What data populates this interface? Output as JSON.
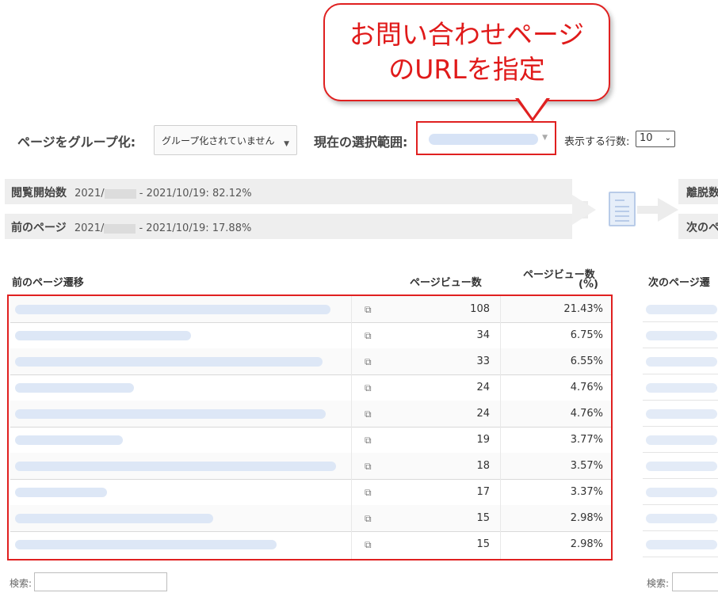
{
  "callout": {
    "line1": "お問い合わせページ",
    "line2": "のURLを指定"
  },
  "controls": {
    "group_label": "ページをグループ化:",
    "group_value": "グループ化されていません",
    "scope_label": "現在の選択範囲:",
    "rows_label": "表示する行数:",
    "rows_value": "10"
  },
  "flow": {
    "entrances_title": "閲覧開始数",
    "entrances_date_start": "2021/",
    "entrances_range": "- 2021/10/19: 82.12%",
    "previous_title": "前のページ",
    "previous_date_start": "2021/",
    "previous_range": "- 2021/10/19: 17.88%",
    "exits_title": "離脱数",
    "next_title": "次のペ"
  },
  "table": {
    "headers": {
      "path": "前のページ遷移",
      "pageviews": "ページビュー数",
      "pct_line1": "ページビュー数",
      "pct_line2": "(%)",
      "next_path": "次のページ遷"
    },
    "rows": [
      {
        "pageviews": "108",
        "pct": "21.43%"
      },
      {
        "pageviews": "34",
        "pct": "6.75%"
      },
      {
        "pageviews": "33",
        "pct": "6.55%"
      },
      {
        "pageviews": "24",
        "pct": "4.76%"
      },
      {
        "pageviews": "24",
        "pct": "4.76%"
      },
      {
        "pageviews": "19",
        "pct": "3.77%"
      },
      {
        "pageviews": "18",
        "pct": "3.57%"
      },
      {
        "pageviews": "17",
        "pct": "3.37%"
      },
      {
        "pageviews": "15",
        "pct": "2.98%"
      },
      {
        "pageviews": "15",
        "pct": "2.98%"
      }
    ]
  },
  "search": {
    "label": "検索:",
    "label_right": "検索:"
  },
  "colors": {
    "highlight": "#e02020",
    "bar": "#eeeeee",
    "link_blur": "#dde7f6"
  }
}
